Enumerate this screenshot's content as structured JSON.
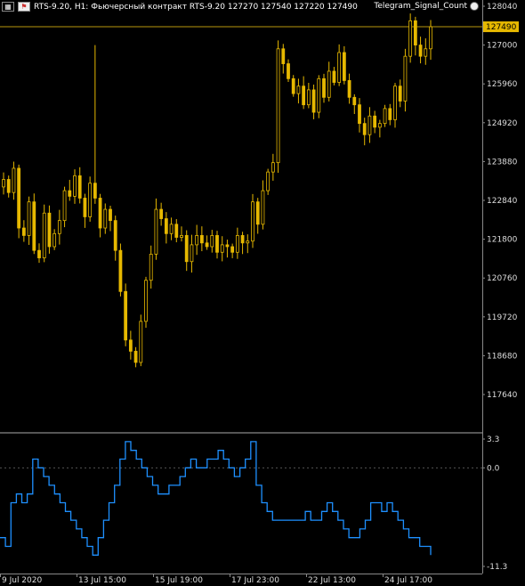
{
  "header": {
    "symbol_line": "RTS-9.20, H1:  Фьючерсный контракт RTS-9.20  127270 127540 127220 127490",
    "icons": [
      "chart-window-icon",
      "flag-icon"
    ]
  },
  "indicator": {
    "label": "Telegram_Signal_Count"
  },
  "price_tag": "127490",
  "colors": {
    "background": "#000000",
    "candle": "#e6b800",
    "current_price_line": "#b8960b",
    "indicator_line": "#1e90ff",
    "grid": "#555555",
    "separator": "#aaaaaa"
  },
  "price_axis": {
    "labels": [
      "128040",
      "127000",
      "125960",
      "124920",
      "123880",
      "122840",
      "121800",
      "120760",
      "119720",
      "118680",
      "117640"
    ]
  },
  "indicator_axis": {
    "labels": [
      "3.3",
      "0.0",
      "-11.3"
    ]
  },
  "time_axis": {
    "labels": [
      "9 Jul 2020",
      "13 Jul 15:00",
      "15 Jul 19:00",
      "17 Jul 23:00",
      "22 Jul 13:00",
      "24 Jul 17:00"
    ]
  },
  "chart_data": [
    {
      "type": "candlestick",
      "symbol": "RTS-9.20",
      "timeframe": "H1",
      "last": {
        "open": 127270,
        "high": 127540,
        "low": 127220,
        "close": 127490
      },
      "ylim": [
        117100,
        128200
      ],
      "y_ticks": [
        128040,
        127000,
        125960,
        124920,
        123880,
        122840,
        121800,
        120760,
        119720,
        118680,
        117640
      ],
      "x_ticks": [
        "9 Jul 2020",
        "13 Jul 15:00",
        "15 Jul 19:00",
        "17 Jul 23:00",
        "22 Jul 13:00",
        "24 Jul 17:00"
      ],
      "close_series": [
        123400,
        123050,
        123700,
        122100,
        121900,
        122800,
        121500,
        121300,
        122500,
        121600,
        121950,
        122300,
        123100,
        122950,
        123500,
        122900,
        122400,
        123300,
        122900,
        122100,
        122600,
        122300,
        121500,
        120400,
        119100,
        118800,
        118500,
        119600,
        120700,
        121400,
        122600,
        122350,
        121950,
        122200,
        121850,
        121900,
        121200,
        121650,
        121900,
        121700,
        121600,
        121900,
        121450,
        121650,
        121600,
        121450,
        121900,
        121700,
        121750,
        122800,
        122200,
        123100,
        123600,
        123850,
        126900,
        126500,
        126100,
        125700,
        125900,
        125400,
        125800,
        125200,
        126100,
        125600,
        126300,
        126000,
        126800,
        126050,
        125600,
        125400,
        124900,
        124600,
        125100,
        124800,
        124900,
        125300,
        125000,
        125900,
        125500,
        126700,
        127650,
        127000,
        126700,
        126900,
        127490
      ],
      "spike_high": {
        "value": 127000,
        "near": "13 Jul"
      }
    },
    {
      "type": "line",
      "name": "Telegram_Signal_Count",
      "ylim": [
        -11.3,
        3.3
      ],
      "y_ticks": [
        3.3,
        0.0,
        -11.3
      ],
      "values": [
        -8,
        -9,
        -4,
        -3,
        -4,
        -3,
        1,
        0,
        -1,
        -2,
        -3,
        -4,
        -5,
        -6,
        -7,
        -8,
        -9,
        -10,
        -8,
        -6,
        -4,
        -2,
        1,
        3,
        2,
        1,
        0,
        -1,
        -2,
        -3,
        -3,
        -2,
        -2,
        -1,
        0,
        1,
        0,
        0,
        1,
        1,
        2,
        1,
        0,
        -1,
        0,
        1,
        3,
        -2,
        -4,
        -5,
        -6,
        -6,
        -6,
        -6,
        -6,
        -6,
        -5,
        -6,
        -6,
        -5,
        -4,
        -5,
        -6,
        -7,
        -8,
        -8,
        -7,
        -6,
        -4,
        -4,
        -5,
        -4,
        -5,
        -6,
        -7,
        -8,
        -8,
        -9,
        -9,
        -10
      ]
    }
  ]
}
